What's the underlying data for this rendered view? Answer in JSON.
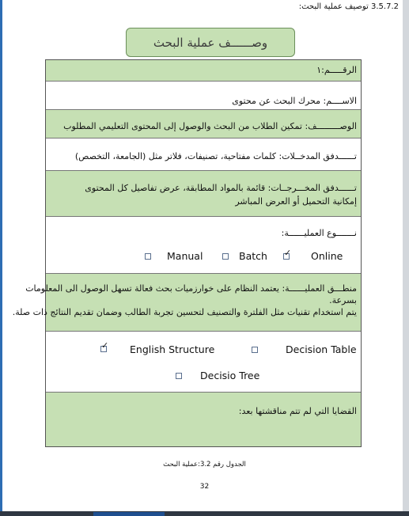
{
  "section_heading": "3.5.7.2 توصيف عملية البحث:",
  "title": "وصــــــف عملية البحث",
  "rows": {
    "number": "الرقـــــم:١",
    "name": "الاســــم: محرك البحث عن محتوى",
    "description": "الوصـــــــــف: تمكين الطلاب من البحث والوصول إلى المحتوى التعليمي المطلوب",
    "input_flow": "تــــــدفق المدخــلات: كلمات مفتاحية، تصنيفات، فلاتر مثل (الجامعة، التخصص)",
    "output_flow_line1": "تــــــدفق المخـــرجــات: قائمة بالمواد المطابقة، عرض تفاصيل كل المحتوى",
    "output_flow_line2": "إمكانية التحميل أو العرض المباشر",
    "process_type_label": "نـــــــوع العمليــــــة:",
    "logic_line1": "منطـــق العمليــــــة: يعتمد النظام على خوارزميات بحث فعالة تسهل الوصول الى المعلومات",
    "logic_line2": "بسرعة.",
    "logic_line3": "يتم استخدام تقنيات مثل الفلترة والتصنيف لتحسين تجربة الطالب وضمان تقديم النتائج ذات صلة.",
    "open_issues": "القضايا التي لم تتم مناقشتها بعد:"
  },
  "process_type_options": [
    {
      "label": "Manual",
      "checked": false
    },
    {
      "label": "Batch",
      "checked": false
    },
    {
      "label": "Online",
      "checked": true
    }
  ],
  "logic_tool_options": [
    {
      "label": "English Structure",
      "checked": true
    },
    {
      "label": "Decision Table",
      "checked": false
    },
    {
      "label": "Decisio Tree",
      "checked": false
    }
  ],
  "check_glyph": "✓",
  "caption": "الجدول رقم 3.2:عملية البحث",
  "page_number": "32",
  "colors": {
    "green_fill": "#c6e0b4",
    "frame_blue": "#2e6db3"
  }
}
